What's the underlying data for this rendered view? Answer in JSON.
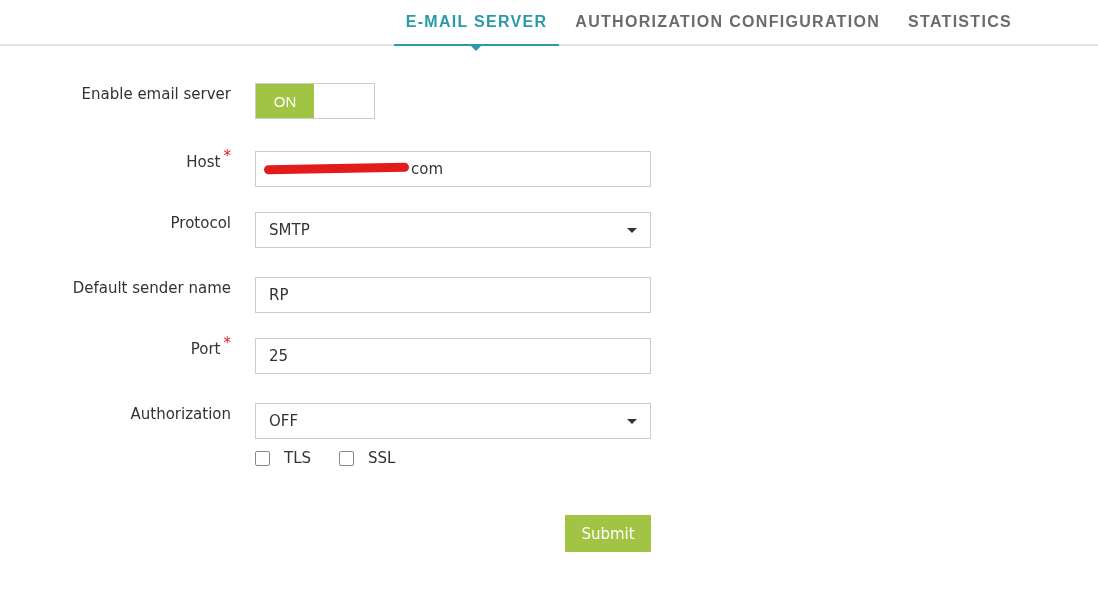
{
  "tabs": [
    {
      "label": "E-MAIL SERVER",
      "selected": true
    },
    {
      "label": "AUTHORIZATION CONFIGURATION",
      "selected": false
    },
    {
      "label": "STATISTICS",
      "selected": false
    }
  ],
  "form": {
    "fields": [
      {
        "kind": "toggle",
        "label": "Enable email server",
        "on": true,
        "on_label": "ON"
      },
      {
        "kind": "text",
        "label": "Host",
        "required_mark": "*",
        "value": "com",
        "redacted": true
      },
      {
        "kind": "select",
        "label": "Protocol",
        "value": "SMTP"
      },
      {
        "kind": "text",
        "label": "Default sender name",
        "value": "RP"
      },
      {
        "kind": "text",
        "label": "Port",
        "required_mark": "*",
        "value": "25"
      },
      {
        "kind": "select",
        "label": "Authorization",
        "value": "OFF"
      }
    ],
    "checkboxes": [
      {
        "label": "TLS",
        "checked": false
      },
      {
        "label": "SSL",
        "checked": false
      }
    ],
    "submit": "Submit"
  }
}
